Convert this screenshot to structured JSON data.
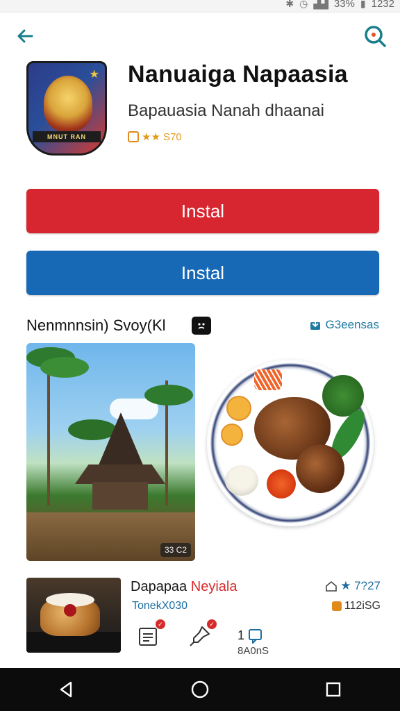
{
  "status_bar": {
    "battery": "33%",
    "time": "1232",
    "icons": [
      "notification-icon",
      "alarm-icon",
      "signal-icon",
      "battery-icon"
    ]
  },
  "top_bar": {
    "back_icon": "arrow-left-icon",
    "search_icon": "search-icon",
    "accent_color": "#1a7e8a"
  },
  "app": {
    "title": "Nanuaiga Napaasia",
    "subtitle": "Bapauasia Nanah dhaanai",
    "rating_text": "★★ S70",
    "icon_banner_text": "MNUT RAN",
    "colors": {
      "brand_red": "#d7262f",
      "brand_blue": "#1769b6"
    }
  },
  "buttons": {
    "primary_label": "Instal",
    "secondary_label": "Instal"
  },
  "section": {
    "title": "Nenmnnsin) Svoy(Kl",
    "badge_icon": "face-icon",
    "link_text": "G3eensas",
    "link_icon": "download-badge-icon"
  },
  "screenshots": {
    "shot1_label": "33 C2",
    "items": [
      "village-scene",
      "food-plate"
    ]
  },
  "list_item": {
    "title_part1": "Dapapaa",
    "title_part2": "Neyiala",
    "subtitle": "TonekX030",
    "rating": "★ 7?27",
    "size": "112iSG",
    "action_count_top": "1",
    "action_count_bottom": "8A0nS",
    "actions": [
      "note-icon",
      "pin-icon",
      "chat-icon"
    ]
  },
  "nav_bar": {
    "items": [
      "back-triangle-icon",
      "home-circle-icon",
      "recents-square-icon"
    ]
  }
}
